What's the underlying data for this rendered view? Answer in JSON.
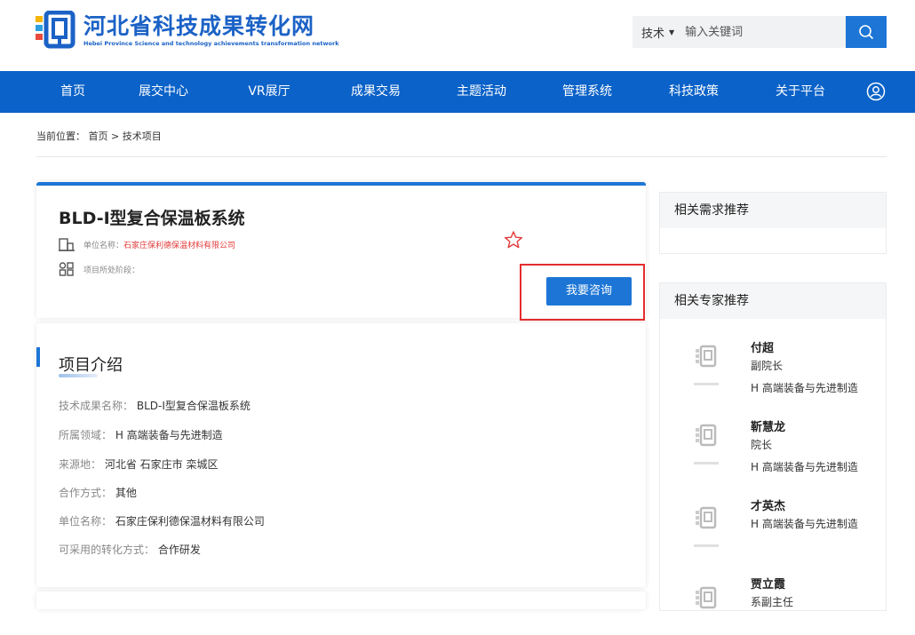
{
  "header": {
    "site_title": "河北省科技成果转化网",
    "site_subtitle": "Hebei Province Science and technology achievements transformation network",
    "search_type": "技术",
    "search_placeholder": "输入关键词"
  },
  "nav": {
    "items": [
      "首页",
      "展交中心",
      "VR展厅",
      "成果交易",
      "主题活动",
      "管理系统",
      "科技政策",
      "关于平台"
    ]
  },
  "breadcrumb": {
    "label": "当前位置：",
    "home": "首页",
    "sep": ">",
    "current": "技术项目"
  },
  "project": {
    "title": "BLD-I型复合保温板系统",
    "unit_label": "单位名称：",
    "unit_value": "石家庄保利德保温材料有限公司",
    "stage_label": "项目所处阶段：",
    "stage_value": "",
    "consult_label": "我要咨询"
  },
  "intro": {
    "title": "项目介绍",
    "rows": [
      {
        "k": "技术成果名称：",
        "v": "BLD-I型复合保温板系统"
      },
      {
        "k": "所属领域：",
        "v": "H 高端装备与先进制造"
      },
      {
        "k": "来源地：",
        "v": "河北省 石家庄市 栾城区"
      },
      {
        "k": "合作方式：",
        "v": "其他"
      },
      {
        "k": "单位名称：",
        "v": "石家庄保利德保温材料有限公司"
      },
      {
        "k": "可采用的转化方式：",
        "v": "合作研发"
      }
    ]
  },
  "sidebar": {
    "demand_title": "相关需求推荐",
    "expert_title": "相关专家推荐",
    "experts": [
      {
        "name": "付超",
        "position": "副院长",
        "field": "H 高端装备与先进制造"
      },
      {
        "name": "靳慧龙",
        "position": "院长",
        "field": "H 高端装备与先进制造"
      },
      {
        "name": "才英杰",
        "position": "",
        "field": "H 高端装备与先进制造"
      },
      {
        "name": "贾立霞",
        "position": "系副主任",
        "field": ""
      }
    ]
  },
  "colors": {
    "brand_blue": "#0b62c8",
    "accent_blue": "#1d76d6",
    "highlight_red": "#e52d2d"
  },
  "icons": {
    "logo": "logo-icon",
    "search": "search-icon",
    "user": "user-circle-icon",
    "building": "building-icon",
    "grid": "grid-icon",
    "favorite": "star-outline-icon",
    "photo_placeholder": "no-photo-icon"
  }
}
